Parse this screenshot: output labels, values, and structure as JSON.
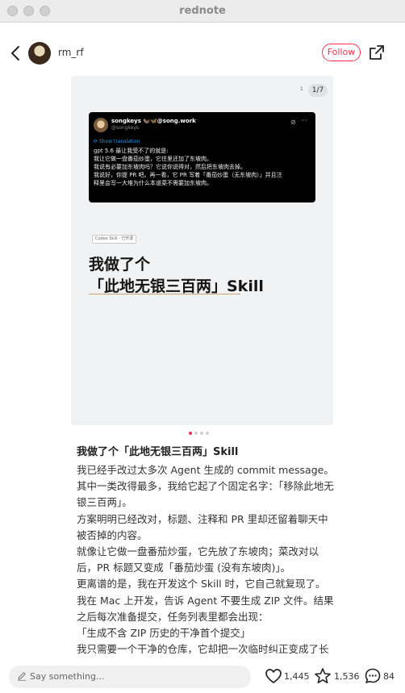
{
  "window": {
    "title": "rednote"
  },
  "author": {
    "username": "rm_rf",
    "follow_label": "Follow"
  },
  "image": {
    "counter": "1/7",
    "side_mark": "1",
    "tweet": {
      "name": "songkeys 🦦🦋@song.work",
      "handle": "@songkeys",
      "translate_label": "Show translation",
      "lines": [
        "gpt 5.6 最让我受不了的就是:",
        "我让它做一盘番茄炒蛋，它往里还加了东坡肉。",
        "我说有必要加东坡肉吗？它说你说得对，然后把东坡肉去掉。",
        "我说好，你提 PR 吧。再一看，它 PR 写着「番茄炒蛋（无东坡肉）」并且注",
        "释里会写一大堆为什么本道菜不需要加东坡肉。"
      ]
    },
    "tag": "Codex Skill · 已开源",
    "headline_line1": "我做了个",
    "headline_line2": "「此地无银三百两」Skill"
  },
  "carousel": {
    "count": 4,
    "active": 0
  },
  "post": {
    "title": "我做了个「此地无银三百两」Skill",
    "body": [
      "我已经手改过太多次 Agent 生成的 commit message。",
      "其中一类改得最多，我给它起了个固定名字：「移除此地无",
      "银三百两」。",
      "方案明明已经改对，标题、注释和 PR 里却还留着聊天中",
      "被否掉的内容。",
      "就像让它做一盘番茄炒蛋，它先放了东坡肉；菜改对以",
      "后，PR 标题又变成「番茄炒蛋 (没有东坡肉)」。",
      "更离谱的是，我在开发这个 Skill 时，它自己就复现了。",
      "我在 Mac 上开发，告诉 Agent 不要生成 ZIP 文件。结果",
      "之后每次准备提交，任务列表里都会出现：",
      "「生成不含 ZIP 历史的干净首个提交」",
      "我只需要一个干净的仓库，它却把一次临时纠正变成了长"
    ]
  },
  "bottom_bar": {
    "comment_placeholder": "Say something...",
    "likes": "1,445",
    "collects": "1,536",
    "comments": "84"
  },
  "colors": {
    "accent": "#ff2e4d",
    "link": "#1d9bf0"
  }
}
